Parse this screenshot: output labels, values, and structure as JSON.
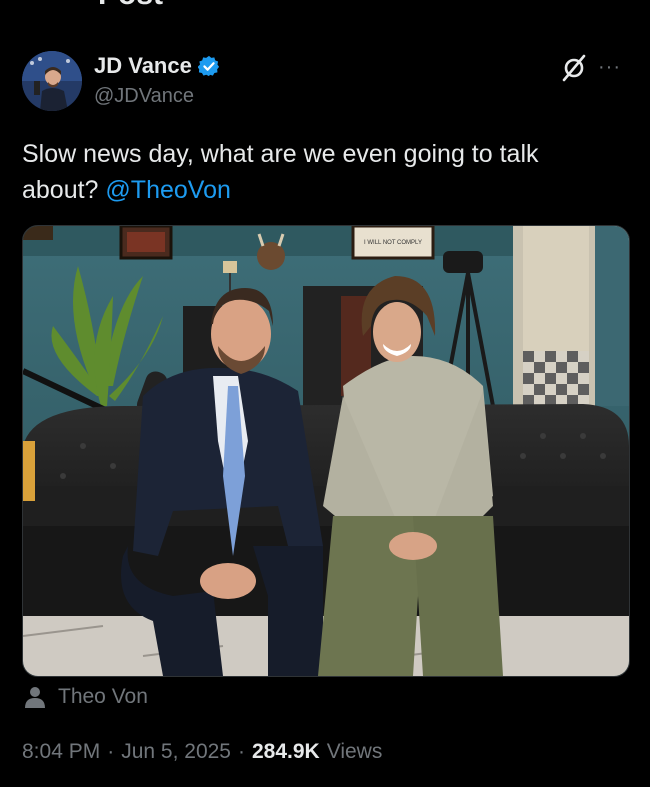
{
  "header": {
    "title": "Post"
  },
  "author": {
    "name": "JD Vance",
    "handle": "@JDVance",
    "verified": true,
    "verified_color": "#1d9bf0"
  },
  "icons": {
    "grok": "grok-slash-icon",
    "more": "more-options-icon",
    "person": "person-icon",
    "verified": "verified-badge-icon"
  },
  "post": {
    "text": "Slow news day, what are we even going to talk about? ",
    "mention": "@TheoVon",
    "mention_color": "#1d9bf0"
  },
  "media": {
    "sign_text": "I WILL NOT COMPLY"
  },
  "tag": {
    "label": "Theo Von"
  },
  "meta": {
    "time": "8:04 PM",
    "sep1": "·",
    "date": "Jun 5, 2025",
    "sep2": "·",
    "views_count": "284.9K",
    "views_label": "Views"
  },
  "more_glyph": "···"
}
